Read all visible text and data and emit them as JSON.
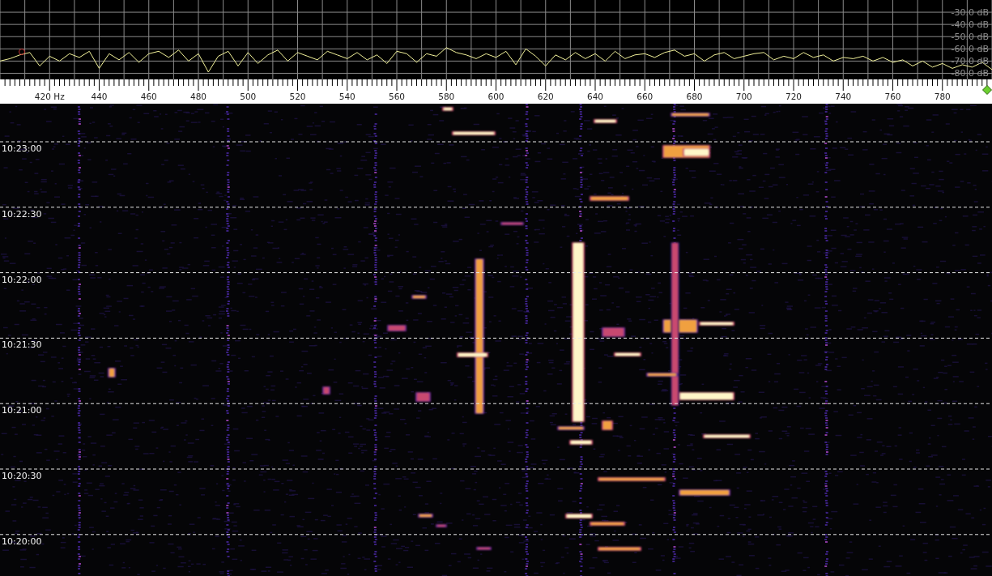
{
  "spectrum": {
    "chart_data": {
      "type": "line",
      "grid": true,
      "xlim": [
        400,
        800
      ],
      "ylim": [
        -85,
        -20
      ],
      "x": [
        400,
        404,
        408,
        412,
        416,
        420,
        424,
        428,
        432,
        436,
        440,
        444,
        448,
        452,
        456,
        460,
        464,
        468,
        472,
        476,
        480,
        484,
        488,
        492,
        496,
        500,
        504,
        508,
        512,
        516,
        520,
        524,
        528,
        532,
        536,
        540,
        544,
        548,
        552,
        556,
        560,
        564,
        568,
        572,
        576,
        580,
        584,
        588,
        592,
        596,
        600,
        604,
        608,
        612,
        616,
        620,
        624,
        628,
        632,
        636,
        640,
        644,
        648,
        652,
        656,
        660,
        664,
        668,
        672,
        676,
        680,
        684,
        688,
        692,
        696,
        700,
        704,
        708,
        712,
        716,
        720,
        724,
        728,
        732,
        736,
        740,
        744,
        748,
        752,
        756,
        760,
        764,
        768,
        772,
        776,
        780,
        784,
        788,
        792,
        796,
        800
      ],
      "series": [
        {
          "color": "#f2f29a",
          "values": [
            -70,
            -68,
            -65,
            -63,
            -74,
            -66,
            -70,
            -64,
            -67,
            -62,
            -76,
            -64,
            -69,
            -63,
            -71,
            -64,
            -62,
            -67,
            -61,
            -70,
            -64,
            -79,
            -66,
            -62,
            -74,
            -63,
            -72,
            -65,
            -61,
            -70,
            -63,
            -66,
            -69,
            -62,
            -65,
            -68,
            -63,
            -69,
            -65,
            -72,
            -62,
            -64,
            -71,
            -64,
            -66,
            -59,
            -63,
            -65,
            -68,
            -64,
            -67,
            -62,
            -73,
            -60,
            -66,
            -74,
            -65,
            -69,
            -63,
            -68,
            -64,
            -70,
            -62,
            -68,
            -65,
            -64,
            -67,
            -63,
            -61,
            -66,
            -64,
            -70,
            -65,
            -63,
            -68,
            -66,
            -64,
            -63,
            -69,
            -66,
            -68,
            -63,
            -67,
            -65,
            -70,
            -67,
            -68,
            -66,
            -70,
            -67,
            -71,
            -69,
            -74,
            -70,
            -75,
            -72,
            -76,
            -73,
            -75,
            -71,
            -77
          ]
        }
      ],
      "xticks": [
        {
          "value": 420,
          "label": "420 Hz"
        },
        440,
        460,
        480,
        500,
        520,
        540,
        560,
        580,
        600,
        620,
        640,
        660,
        680,
        700,
        720,
        740,
        760,
        780
      ],
      "yticks": [
        {
          "value": -30,
          "label": "-30.0 dB"
        },
        {
          "value": -40,
          "label": "-40.0 dB"
        },
        {
          "value": -50,
          "label": "-50.0 dB"
        },
        {
          "value": -60,
          "label": "-60.0 dB"
        },
        {
          "value": -70,
          "label": "-70.0 dB"
        },
        {
          "value": -80,
          "label": "-80.0 dB"
        }
      ]
    }
  },
  "waterfall": {
    "time_labels": [
      "10:23:00",
      "10:22:30",
      "10:22:00",
      "10:21:30",
      "10:21:00",
      "10:20:30",
      "10:20:00"
    ]
  }
}
